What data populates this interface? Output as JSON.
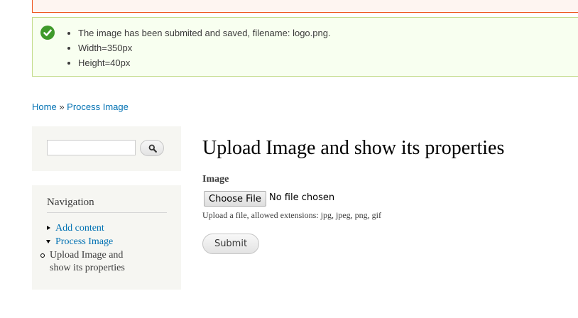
{
  "status": {
    "items": [
      "The image has been submited and saved, filename: logo.png.",
      "Width=350px",
      "Height=40px"
    ],
    "icon": "check-circle-icon",
    "color": "#3f9a2b"
  },
  "breadcrumb": {
    "home": "Home",
    "separator": "»",
    "current": "Process Image"
  },
  "search": {
    "value": "",
    "button_icon": "search-icon"
  },
  "navigation": {
    "title": "Navigation",
    "items": [
      {
        "label": "Add content"
      },
      {
        "label": "Process Image"
      }
    ],
    "sub_item": "Upload Image and show its properties"
  },
  "main": {
    "title": "Upload Image and show its properties",
    "field_label": "Image",
    "choose_file": "Choose File",
    "no_file": "No file chosen",
    "description": "Upload a file, allowed extensions: jpg, jpeg, png, gif",
    "submit": "Submit"
  },
  "colors": {
    "link": "#0071b3",
    "status_border": "#c2dc8a",
    "error_border": "#ed541d"
  }
}
